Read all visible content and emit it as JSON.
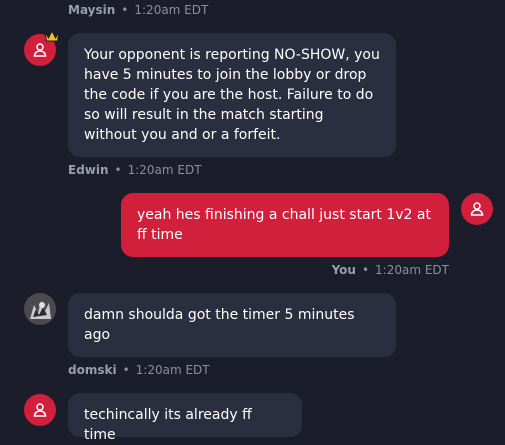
{
  "messages": [
    {
      "author": "Maysin",
      "time": "1:20am EDT"
    },
    {
      "author": "Edwin",
      "time": "1:20am EDT",
      "text": "Your opponent is reporting NO-SHOW, you have 5 minutes to join the lobby or drop the code if you are the host. Failure to do so will result in the match starting without you and or a forfeit."
    },
    {
      "author": "You",
      "time": "1:20am EDT",
      "text": "yeah hes finishing a chall just start 1v2 at ff time"
    },
    {
      "author": "domski",
      "time": "1:20am EDT",
      "text": "damn shoulda got the timer 5 minutes ago"
    },
    {
      "text": "techincally its already ff time"
    }
  ],
  "meta_separator": "•",
  "colors": {
    "background": "#1b1d2a",
    "incoming_bubble": "#2b2e3e",
    "outgoing_bubble": "#d21f3c",
    "avatar": "#d21f3c",
    "crown": "#f2c21a"
  },
  "icons": {
    "default_avatar": "user-icon",
    "moderator": "crown-icon"
  }
}
